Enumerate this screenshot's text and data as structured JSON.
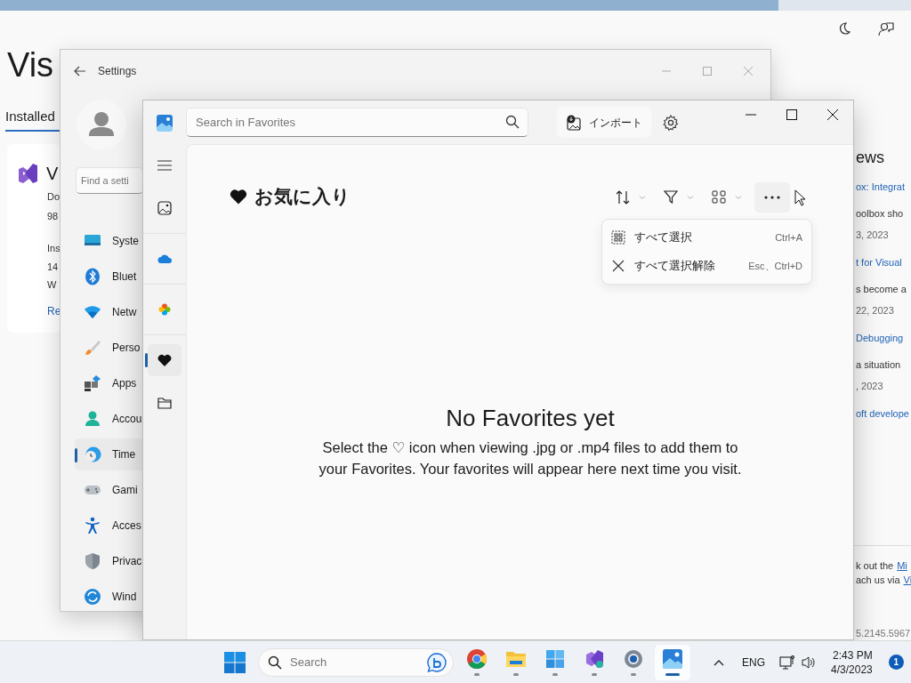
{
  "background_window": {
    "title": "Vis",
    "tab": "Installed",
    "product": {
      "name": "V",
      "lines": [
        "Do",
        "98",
        "Ins",
        "14",
        "W"
      ],
      "link": "Re"
    },
    "news": {
      "heading": "ews",
      "items": [
        {
          "title": "ox: Integrat",
          "text": "oolbox sho",
          "date": "3, 2023"
        },
        {
          "title": "t for Visual",
          "text": "s become a",
          "date": "22, 2023"
        },
        {
          "title": "Debugging",
          "text": "a situation",
          "date": ", 2023"
        },
        {
          "title": "oft develope"
        }
      ]
    },
    "footer": [
      {
        "text": "k out the",
        "link": "Mi"
      },
      {
        "text": "ach us via",
        "link": "Vi"
      }
    ],
    "version": "5.2145.5967"
  },
  "settings": {
    "title": "Settings",
    "search": {
      "placeholder": "Find a setti"
    },
    "nav": [
      {
        "label": "Syste",
        "selected": false
      },
      {
        "label": "Bluet",
        "selected": false
      },
      {
        "label": "Netw",
        "selected": false
      },
      {
        "label": "Perso",
        "selected": false
      },
      {
        "label": "Apps",
        "selected": false
      },
      {
        "label": "Accou",
        "selected": false
      },
      {
        "label": "Time",
        "selected": true
      },
      {
        "label": "Gami",
        "selected": false
      },
      {
        "label": "Acces",
        "selected": false
      },
      {
        "label": "Privac",
        "selected": false
      },
      {
        "label": "Wind",
        "selected": false
      }
    ]
  },
  "photos": {
    "search": {
      "placeholder": "Search in Favorites"
    },
    "import_label": "インポート",
    "rail": [
      {
        "selected": false
      },
      {
        "selected": false
      },
      {
        "selected": false
      },
      {
        "selected": true
      },
      {
        "selected": false
      }
    ],
    "heading": "お気に入り",
    "menu": [
      {
        "label": "すべて選択",
        "shortcut": "Ctrl+A"
      },
      {
        "label": "すべて選択解除",
        "shortcut": "Esc、Ctrl+D"
      }
    ],
    "empty_title": "No Favorites yet",
    "empty_message": "Select the ♡ icon when viewing .jpg or .mp4 files to add them to your Favorites. Your favorites will appear here next time you visit."
  },
  "taskbar": {
    "search": {
      "placeholder": "Search"
    },
    "apps": [
      {
        "active": false
      },
      {
        "active": false
      },
      {
        "active": false
      },
      {
        "active": false
      },
      {
        "active": false
      },
      {
        "active": true
      }
    ],
    "language": "ENG",
    "time": "2:43 PM",
    "date": "4/3/2023",
    "notifications": "1"
  }
}
